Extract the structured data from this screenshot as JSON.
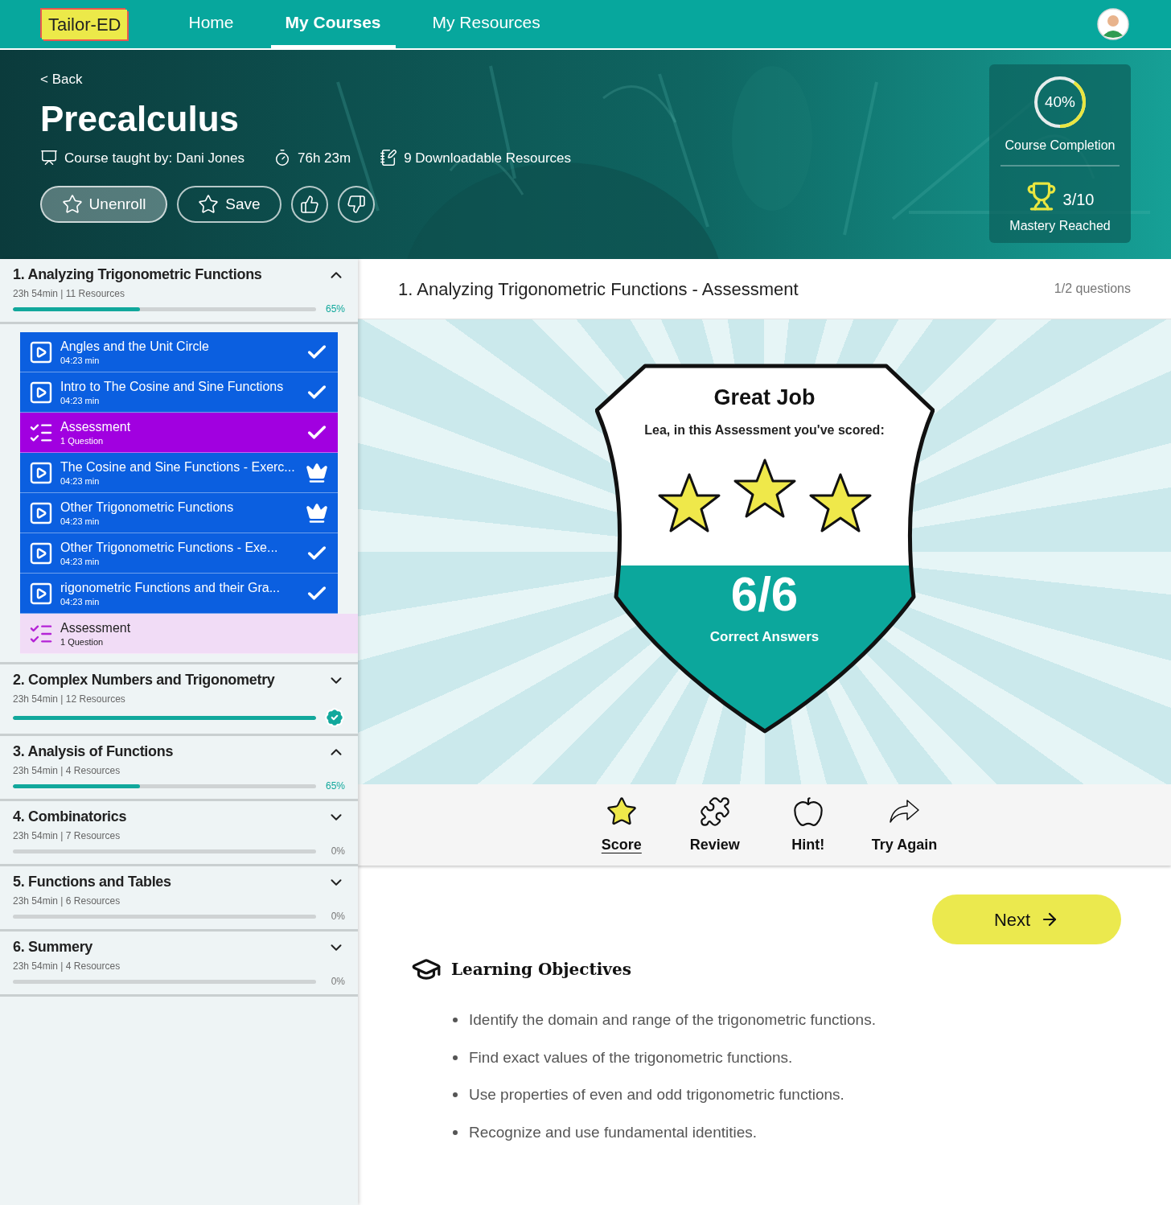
{
  "nav": {
    "logo": "Tailor-ED",
    "tabs": [
      {
        "label": "Home",
        "selected": false
      },
      {
        "label": "My Courses",
        "selected": true
      },
      {
        "label": "My Resources",
        "selected": false
      }
    ]
  },
  "course": {
    "back": "< Back",
    "title": "Precalculus",
    "meta": [
      {
        "kind": "teacher",
        "text": "Course taught by: Dani Jones"
      },
      {
        "kind": "duration",
        "text": "76h 23m"
      },
      {
        "kind": "resources",
        "text": "9 Downloadable Resources"
      }
    ],
    "buttons": [
      {
        "kind": "unenroll",
        "label": "Unenroll"
      },
      {
        "kind": "save",
        "label": "Save"
      },
      {
        "kind": "like"
      },
      {
        "kind": "dislike"
      }
    ],
    "completion": {
      "value": "40%",
      "label": "Course Completion",
      "level": 0.4
    },
    "mastery": {
      "value": "3/10",
      "label": "Mastery Reached"
    }
  },
  "modules": [
    {
      "title": "1. Analyzing Trigonometric Functions",
      "meta": "23h 54min | 11 Resources",
      "level": 0.42,
      "percent": "65%",
      "completed": false,
      "expanded": true,
      "lessons": [
        {
          "kind": "video",
          "title": "Angles and the Unit Circle",
          "subtitle": "04:23 min",
          "completed": true,
          "mastered": false,
          "selected": false
        },
        {
          "kind": "video",
          "title": "Intro to The Cosine and Sine Functions",
          "subtitle": "04:23 min",
          "completed": true,
          "mastered": false,
          "selected": false
        },
        {
          "kind": "assessment",
          "title": "Assessment",
          "subtitle": "1 Question",
          "completed": true,
          "mastered": false,
          "selected": true
        },
        {
          "kind": "video",
          "title": "The Cosine and Sine Functions - Exerc...",
          "subtitle": "04:23 min",
          "completed": true,
          "mastered": true,
          "selected": false
        },
        {
          "kind": "video",
          "title": "Other Trigonometric Functions",
          "subtitle": "04:23 min",
          "completed": true,
          "mastered": true,
          "selected": false
        },
        {
          "kind": "video",
          "title": "Other Trigonometric Functions - Exe...",
          "subtitle": "04:23 min",
          "completed": true,
          "mastered": false,
          "selected": false
        },
        {
          "kind": "video",
          "title": "rigonometric Functions and their Gra...",
          "subtitle": "04:23 min",
          "completed": true,
          "mastered": false,
          "selected": false
        },
        {
          "kind": "assessment",
          "title": "Assessment",
          "subtitle": "1 Question",
          "completed": false,
          "mastered": false,
          "selected": false
        }
      ]
    },
    {
      "title": "2. Complex Numbers and Trigonometry",
      "meta": "23h 54min | 12 Resources",
      "level": 1,
      "completed": true,
      "expanded": false
    },
    {
      "title": "3. Analysis of Functions",
      "meta": "23h 54min | 4 Resources",
      "level": 0.42,
      "percent": "65%",
      "completed": false,
      "expanded": true
    },
    {
      "title": "4. Combinatorics",
      "meta": "23h 54min | 7 Resources",
      "level": 0,
      "percent": "0%",
      "completed": false,
      "expanded": false
    },
    {
      "title": "5. Functions and Tables",
      "meta": "23h 54min | 6 Resources",
      "level": 0,
      "percent": "0%",
      "completed": false,
      "expanded": false
    },
    {
      "title": "6. Summery",
      "meta": "23h 54min | 4 Resources",
      "level": 0,
      "percent": "0%",
      "completed": false,
      "expanded": false
    }
  ],
  "assessment": {
    "title": "1. Analyzing Trigonometric Functions - Assessment",
    "progress": "1/2 questions"
  },
  "result": {
    "title": "Great Job",
    "subtitle": "Lea, in this Assessment you've scored:",
    "stars": 3,
    "score": "6/6",
    "score_label": "Correct Answers"
  },
  "actions": [
    {
      "kind": "score",
      "label": "Score",
      "selected": true
    },
    {
      "kind": "review",
      "label": "Review",
      "selected": false
    },
    {
      "kind": "hint",
      "label": "Hint!",
      "selected": false
    },
    {
      "kind": "retry",
      "label": "Try Again",
      "selected": false
    }
  ],
  "next": {
    "label": "Next"
  },
  "objectives": {
    "title": "Learning Objectives",
    "items": [
      "Identify the domain and range of the trigonometric functions.",
      "Find exact values of the trigonometric functions.",
      "Use properties of even and odd trigonometric functions.",
      "Recognize and use fundamental identities."
    ]
  }
}
